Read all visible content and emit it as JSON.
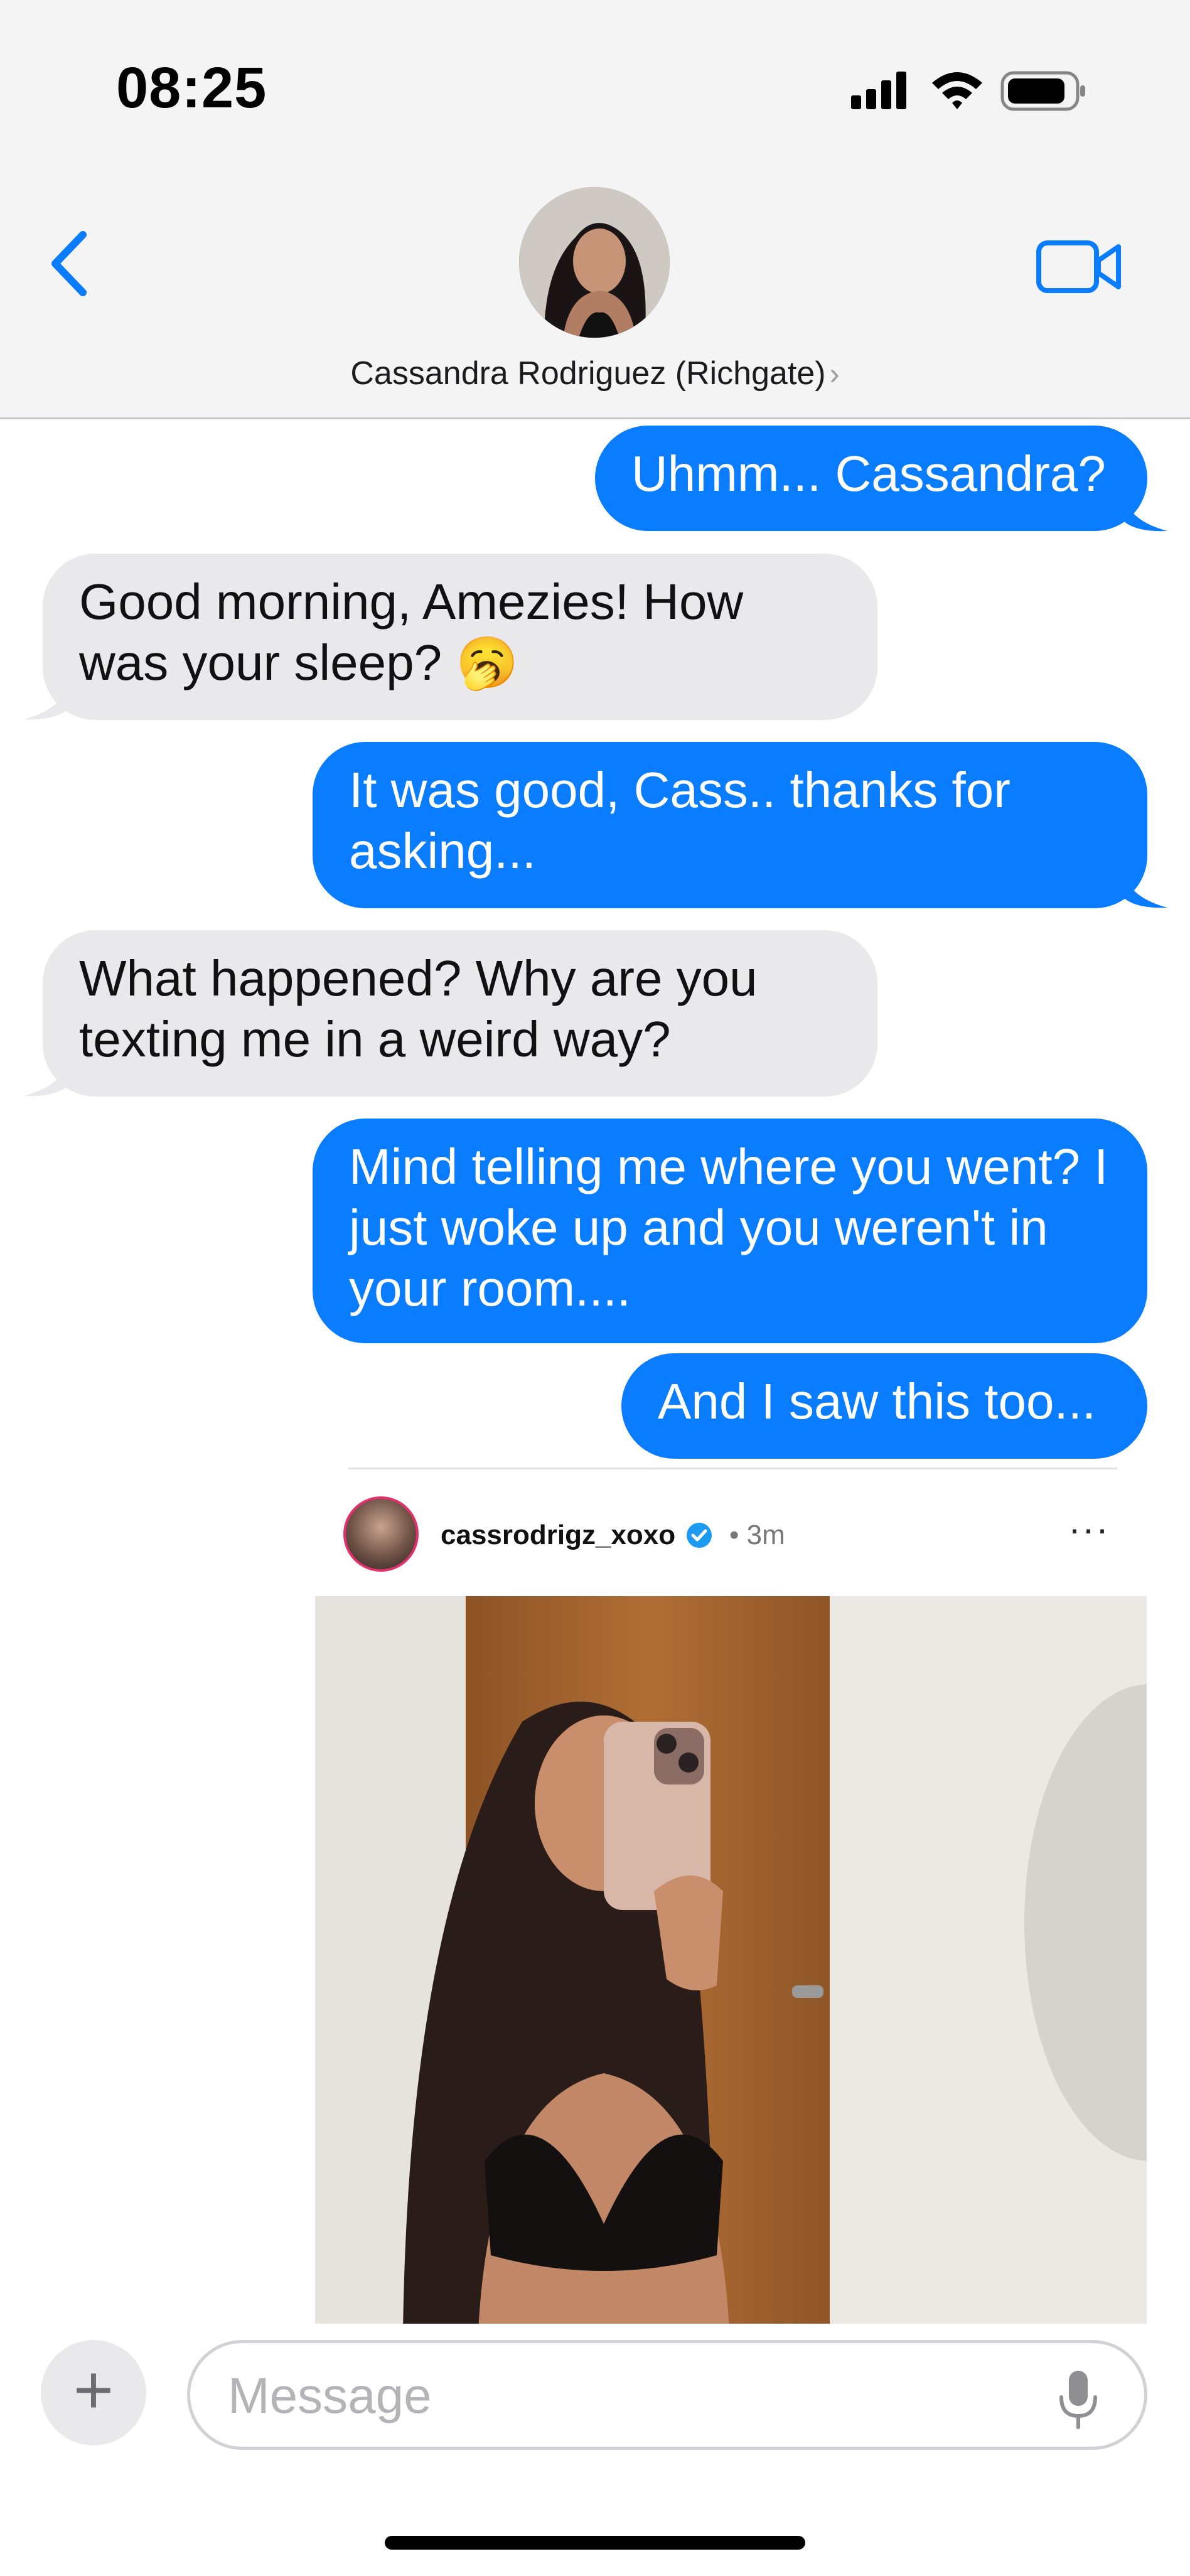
{
  "status_bar": {
    "time": "08:25"
  },
  "header": {
    "contact_name": "Cassandra Rodriguez (Richgate)",
    "chevron": "›"
  },
  "messages": [
    {
      "side": "out",
      "text": "Uhmm... Cassandra?"
    },
    {
      "side": "in",
      "text": "Good morning, Amezies! How was your sleep? 🥱"
    },
    {
      "side": "out",
      "text": "It was good, Cass.. thanks for asking..."
    },
    {
      "side": "in",
      "text": "What happened? Why are you texting me in a weird way?"
    },
    {
      "side": "out",
      "text": "Mind telling me where you went? I just woke up and you weren't in your room...."
    },
    {
      "side": "out",
      "text": "And I saw this too..."
    }
  ],
  "shared_post": {
    "username": "cassrodrigz_xoxo",
    "time": "• 3m",
    "more": "···"
  },
  "composer": {
    "plus": "+",
    "placeholder": "Message"
  },
  "colors": {
    "accent": "#0a7cff",
    "incoming_bubble": "#e9e9eb"
  },
  "icons": [
    "signal-icon",
    "wifi-icon",
    "battery-icon",
    "back-chevron-icon",
    "video-call-icon",
    "verified-badge-icon",
    "microphone-icon"
  ]
}
